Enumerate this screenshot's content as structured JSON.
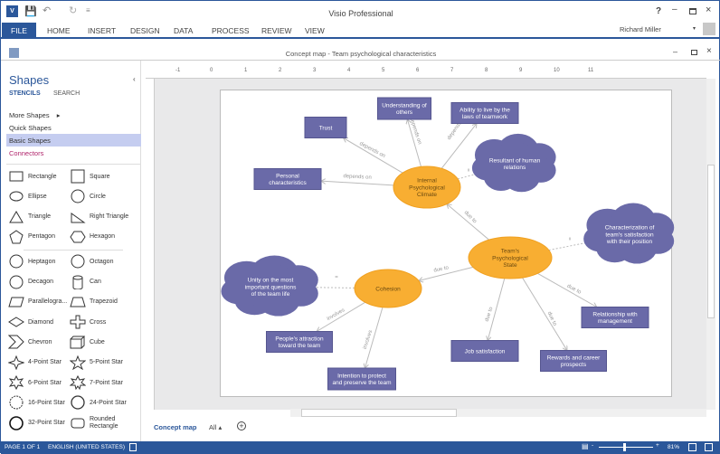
{
  "app": {
    "title": "Visio Professional",
    "user": "Richard Miller"
  },
  "ribbon": {
    "file": "FILE",
    "tabs": [
      "HOME",
      "INSERT",
      "DESIGN",
      "DATA",
      "PROCESS",
      "REVIEW",
      "VIEW"
    ]
  },
  "document": {
    "title": "Concept map - Team psychological characteristics"
  },
  "shapes_panel": {
    "title": "Shapes",
    "tabs": [
      "STENCILS",
      "SEARCH"
    ],
    "more_shapes": "More Shapes",
    "quick_shapes": "Quick Shapes",
    "basic_shapes": "Basic Shapes",
    "connectors": "Connectors",
    "items": [
      "Rectangle",
      "Square",
      "Ellipse",
      "Circle",
      "Triangle",
      "Right Triangle",
      "Pentagon",
      "Hexagon",
      "Heptagon",
      "Octagon",
      "Decagon",
      "Can",
      "Parallelogra...",
      "Trapezoid",
      "Diamond",
      "Cross",
      "Chevron",
      "Cube",
      "4-Point Star",
      "5-Point Star",
      "6-Point Star",
      "7-Point Star",
      "16-Point Star",
      "24-Point Star",
      "32-Point Star",
      "Rounded Rectangle"
    ]
  },
  "ruler": {
    "labels": [
      "-1",
      "0",
      "1",
      "2",
      "3",
      "4",
      "5",
      "6",
      "7",
      "8",
      "9",
      "10",
      "11"
    ]
  },
  "diagram": {
    "colors": {
      "box": "#6a6aa8",
      "ellipse": "#f8ae32",
      "edge": "#bbbbbb"
    },
    "nodes": {
      "trust": "Trust",
      "understanding": "Understanding of others",
      "ability": "Ability to live by the laws of teamwork",
      "personal": "Personal characteristics",
      "resultant": "Resultant of human relations",
      "internal": "Internal Psychological Climate",
      "state": "Team's Psychological State",
      "characterization": "Characterization of team's satisfaction with their position",
      "unity": "Unity on the most important questions of the team life",
      "cohesion": "Cohesion",
      "attraction": "People's attraction toward the team",
      "intention": "Intention to protect and preserve the team",
      "job": "Job satisfaction",
      "rewards": "Rewards and career prospects",
      "relationship": "Relationship with management"
    },
    "edge_labels": {
      "depends_on": "depends on",
      "due_to": "due to",
      "involves": "involves",
      "equals": "="
    }
  },
  "page_tabs": {
    "active": "Concept map",
    "all": "All"
  },
  "status": {
    "page": "PAGE 1 OF 1",
    "language": "ENGLISH (UNITED STATES)",
    "zoom": "81%"
  }
}
